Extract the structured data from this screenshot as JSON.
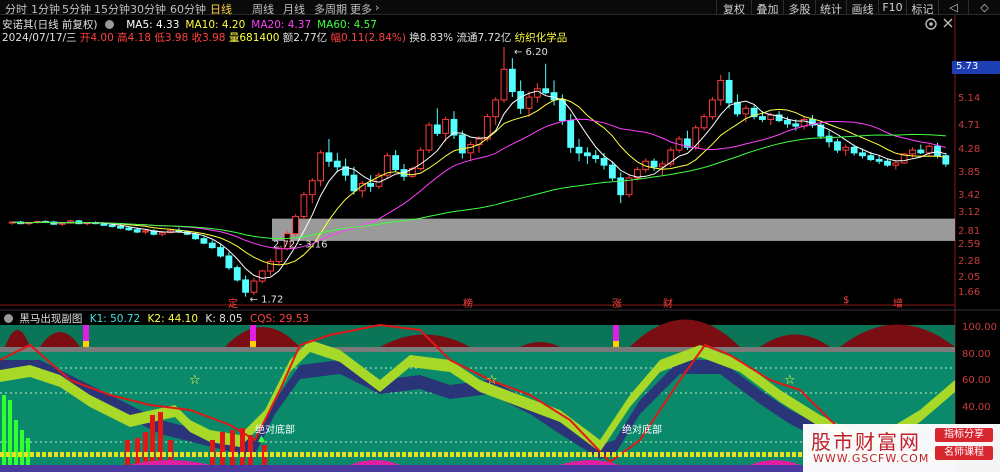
{
  "toolbar": {
    "timeframes": [
      "分时",
      "1分钟",
      "5分钟",
      "15分钟",
      "30分钟",
      "60分钟",
      "日线",
      "周线",
      "月线",
      "多周期",
      "更多"
    ],
    "active": "日线",
    "more_arrow": "›",
    "tools": [
      "复权",
      "叠加",
      "多股",
      "统计",
      "画线",
      "F10",
      "标记",
      "◁",
      "◇"
    ]
  },
  "header": {
    "stock_name": "安诺其(日线 前复权)",
    "ma": [
      {
        "label": "MA5: 4.33",
        "color": "#ffffff"
      },
      {
        "label": "MA10: 4.20",
        "color": "#ffff40"
      },
      {
        "label": "MA20: 4.37",
        "color": "#ff40ff"
      },
      {
        "label": "MA60: 4.57",
        "color": "#40ff40"
      }
    ],
    "date": "2024/07/17/三",
    "open": "开4.00",
    "high": "高4.18",
    "low": "低3.98",
    "close": "收3.98",
    "volume": "量681400",
    "amount": "额2.77亿",
    "change": "幅0.11(2.84%)",
    "turnover": "换8.83%",
    "float": "流通7.72亿",
    "industry": "纺织化学品"
  },
  "price_axis": [
    "5.73",
    "5.14",
    "4.71",
    "4.28",
    "3.85",
    "3.42",
    "3.12",
    "2.81",
    "2.59",
    "2.28",
    "2.05",
    "1.66"
  ],
  "current_price": "5.73",
  "annotations": {
    "high": "6.20",
    "low": "1.72",
    "range": "2.72 - 3.16"
  },
  "events": [
    "定",
    "榜",
    "涨",
    "财",
    "$",
    "增"
  ],
  "indicator": {
    "title": "黑马出现副图",
    "k1": "K1: 50.72",
    "k2": "K2: 44.10",
    "k": "K: 8.05",
    "cqs": "CQS: 29.53",
    "axis": [
      "100.00",
      "80.00",
      "60.00",
      "40.00"
    ],
    "signals": [
      "绝对底部",
      "绝对底部",
      "绝对底部"
    ],
    "star": "☆"
  },
  "watermark": {
    "title": "股市财富网",
    "url": "WWW.GSCFW.COM",
    "btn1": "指标分享",
    "btn2": "名师课程"
  },
  "chart_data": {
    "type": "candlestick",
    "price_ylim": [
      1.66,
      6.2
    ],
    "candles": [
      [
        3.04,
        3.07,
        3.01,
        3.06
      ],
      [
        3.06,
        3.08,
        3.02,
        3.03
      ],
      [
        3.03,
        3.06,
        3.0,
        3.05
      ],
      [
        3.05,
        3.08,
        3.03,
        3.07
      ],
      [
        3.07,
        3.09,
        3.04,
        3.06
      ],
      [
        3.06,
        3.08,
        3.01,
        3.02
      ],
      [
        3.02,
        3.05,
        2.99,
        3.04
      ],
      [
        3.04,
        3.1,
        3.03,
        3.08
      ],
      [
        3.08,
        3.1,
        3.02,
        3.03
      ],
      [
        3.03,
        3.06,
        3.0,
        3.05
      ],
      [
        3.05,
        3.07,
        3.02,
        3.03
      ],
      [
        3.03,
        3.05,
        2.99,
        3.0
      ],
      [
        3.0,
        3.04,
        2.96,
        2.98
      ],
      [
        2.98,
        3.01,
        2.93,
        2.95
      ],
      [
        2.95,
        2.98,
        2.9,
        2.92
      ],
      [
        2.92,
        2.96,
        2.86,
        2.88
      ],
      [
        2.88,
        2.92,
        2.84,
        2.9
      ],
      [
        2.9,
        2.93,
        2.82,
        2.84
      ],
      [
        2.84,
        2.9,
        2.8,
        2.87
      ],
      [
        2.87,
        2.93,
        2.85,
        2.91
      ],
      [
        2.91,
        2.96,
        2.86,
        2.88
      ],
      [
        2.88,
        2.91,
        2.82,
        2.84
      ],
      [
        2.84,
        2.88,
        2.74,
        2.76
      ],
      [
        2.76,
        2.8,
        2.66,
        2.68
      ],
      [
        2.68,
        2.73,
        2.58,
        2.6
      ],
      [
        2.6,
        2.66,
        2.42,
        2.45
      ],
      [
        2.45,
        2.52,
        2.2,
        2.24
      ],
      [
        2.24,
        2.28,
        1.99,
        2.02
      ],
      [
        2.02,
        2.1,
        1.72,
        1.8
      ],
      [
        1.8,
        2.05,
        1.75,
        2.0
      ],
      [
        2.0,
        2.2,
        1.96,
        2.18
      ],
      [
        2.18,
        2.4,
        2.1,
        2.35
      ],
      [
        2.35,
        2.62,
        2.3,
        2.58
      ],
      [
        2.58,
        2.9,
        2.55,
        2.85
      ],
      [
        2.85,
        3.2,
        2.8,
        3.16
      ],
      [
        3.16,
        3.6,
        3.1,
        3.55
      ],
      [
        3.55,
        3.85,
        3.4,
        3.8
      ],
      [
        3.8,
        4.35,
        3.7,
        4.3
      ],
      [
        4.3,
        4.55,
        4.05,
        4.15
      ],
      [
        4.15,
        4.3,
        3.95,
        4.05
      ],
      [
        4.05,
        4.2,
        3.8,
        3.9
      ],
      [
        3.9,
        4.05,
        3.55,
        3.62
      ],
      [
        3.62,
        3.8,
        3.5,
        3.75
      ],
      [
        3.75,
        3.9,
        3.6,
        3.7
      ],
      [
        3.7,
        3.95,
        3.65,
        3.9
      ],
      [
        3.9,
        4.3,
        3.85,
        4.25
      ],
      [
        4.25,
        4.35,
        3.95,
        4.0
      ],
      [
        4.0,
        4.1,
        3.8,
        3.88
      ],
      [
        3.88,
        4.05,
        3.85,
        4.02
      ],
      [
        4.02,
        4.4,
        3.98,
        4.35
      ],
      [
        4.35,
        4.85,
        4.3,
        4.8
      ],
      [
        4.8,
        5.1,
        4.6,
        4.65
      ],
      [
        4.65,
        4.95,
        4.5,
        4.9
      ],
      [
        4.9,
        5.05,
        4.55,
        4.62
      ],
      [
        4.62,
        4.7,
        4.2,
        4.3
      ],
      [
        4.3,
        4.5,
        4.15,
        4.45
      ],
      [
        4.45,
        4.6,
        4.3,
        4.55
      ],
      [
        4.55,
        5.0,
        4.5,
        4.95
      ],
      [
        4.95,
        5.3,
        4.8,
        5.25
      ],
      [
        5.25,
        6.2,
        5.2,
        5.8
      ],
      [
        5.8,
        6.0,
        5.3,
        5.4
      ],
      [
        5.4,
        5.6,
        5.0,
        5.1
      ],
      [
        5.1,
        5.4,
        4.95,
        5.3
      ],
      [
        5.3,
        5.55,
        5.2,
        5.45
      ],
      [
        5.45,
        5.9,
        5.35,
        5.38
      ],
      [
        5.38,
        5.6,
        5.15,
        5.25
      ],
      [
        5.25,
        5.35,
        4.8,
        4.88
      ],
      [
        4.88,
        5.0,
        4.3,
        4.4
      ],
      [
        4.4,
        4.55,
        4.15,
        4.3
      ],
      [
        4.3,
        4.4,
        4.1,
        4.25
      ],
      [
        4.25,
        4.35,
        4.12,
        4.2
      ],
      [
        4.2,
        4.3,
        4.0,
        4.08
      ],
      [
        4.08,
        4.15,
        3.8,
        3.85
      ],
      [
        3.85,
        3.95,
        3.4,
        3.55
      ],
      [
        3.55,
        3.9,
        3.5,
        3.85
      ],
      [
        3.85,
        4.05,
        3.8,
        4.0
      ],
      [
        4.0,
        4.2,
        3.95,
        4.15
      ],
      [
        4.15,
        4.2,
        3.98,
        4.05
      ],
      [
        4.05,
        4.15,
        3.9,
        4.1
      ],
      [
        4.1,
        4.4,
        4.05,
        4.35
      ],
      [
        4.35,
        4.6,
        4.3,
        4.55
      ],
      [
        4.55,
        4.7,
        4.35,
        4.4
      ],
      [
        4.4,
        4.8,
        4.35,
        4.75
      ],
      [
        4.75,
        5.0,
        4.7,
        4.95
      ],
      [
        4.95,
        5.3,
        4.9,
        5.25
      ],
      [
        5.25,
        5.7,
        5.15,
        5.6
      ],
      [
        5.6,
        5.75,
        5.1,
        5.2
      ],
      [
        5.2,
        5.35,
        4.95,
        5.0
      ],
      [
        5.0,
        5.15,
        4.85,
        5.1
      ],
      [
        5.1,
        5.15,
        4.9,
        4.95
      ],
      [
        4.95,
        5.05,
        4.85,
        4.9
      ],
      [
        4.9,
        5.02,
        4.8,
        4.98
      ],
      [
        4.98,
        5.05,
        4.85,
        4.88
      ],
      [
        4.88,
        4.95,
        4.75,
        4.82
      ],
      [
        4.82,
        4.9,
        4.7,
        4.78
      ],
      [
        4.78,
        4.95,
        4.72,
        4.9
      ],
      [
        4.9,
        4.98,
        4.75,
        4.8
      ],
      [
        4.8,
        4.85,
        4.55,
        4.6
      ],
      [
        4.6,
        4.7,
        4.4,
        4.5
      ],
      [
        4.5,
        4.55,
        4.3,
        4.35
      ],
      [
        4.35,
        4.45,
        4.25,
        4.4
      ],
      [
        4.4,
        4.45,
        4.25,
        4.3
      ],
      [
        4.3,
        4.38,
        4.2,
        4.25
      ],
      [
        4.25,
        4.32,
        4.15,
        4.18
      ],
      [
        4.18,
        4.25,
        4.1,
        4.15
      ],
      [
        4.15,
        4.2,
        4.05,
        4.08
      ],
      [
        4.08,
        4.15,
        4.0,
        4.12
      ],
      [
        4.12,
        4.3,
        4.1,
        4.28
      ],
      [
        4.28,
        4.4,
        4.22,
        4.35
      ],
      [
        4.35,
        4.45,
        4.28,
        4.3
      ],
      [
        4.3,
        4.45,
        4.25,
        4.42
      ],
      [
        4.42,
        4.48,
        4.2,
        4.25
      ],
      [
        4.25,
        4.3,
        4.05,
        4.1
      ]
    ]
  }
}
